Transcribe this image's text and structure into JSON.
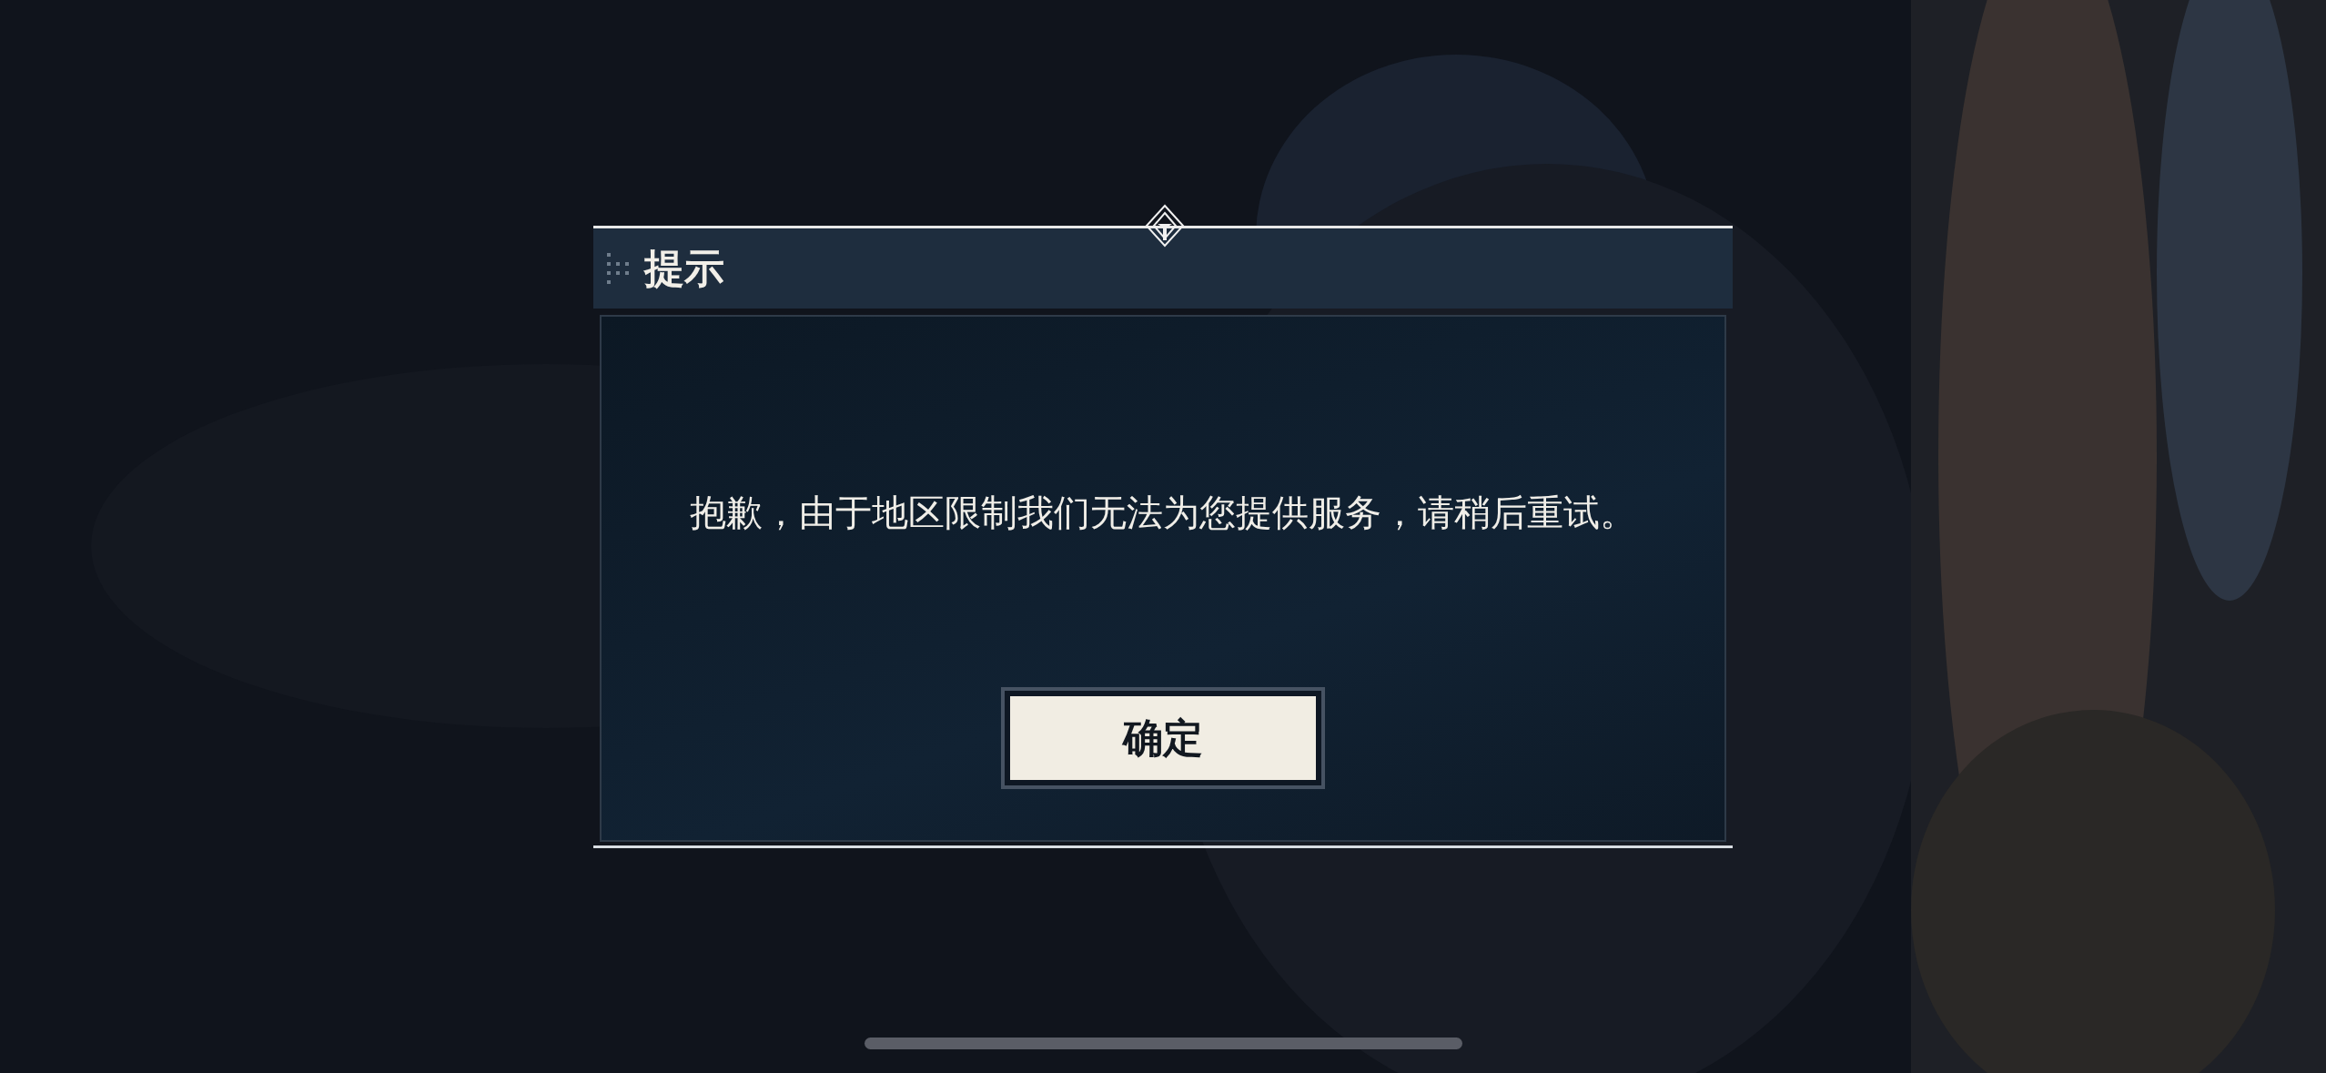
{
  "dialog": {
    "title": "提示",
    "message": "抱歉，由于地区限制我们无法为您提供服务，请稍后重试。",
    "buttons": [
      {
        "label": "确定"
      }
    ]
  }
}
